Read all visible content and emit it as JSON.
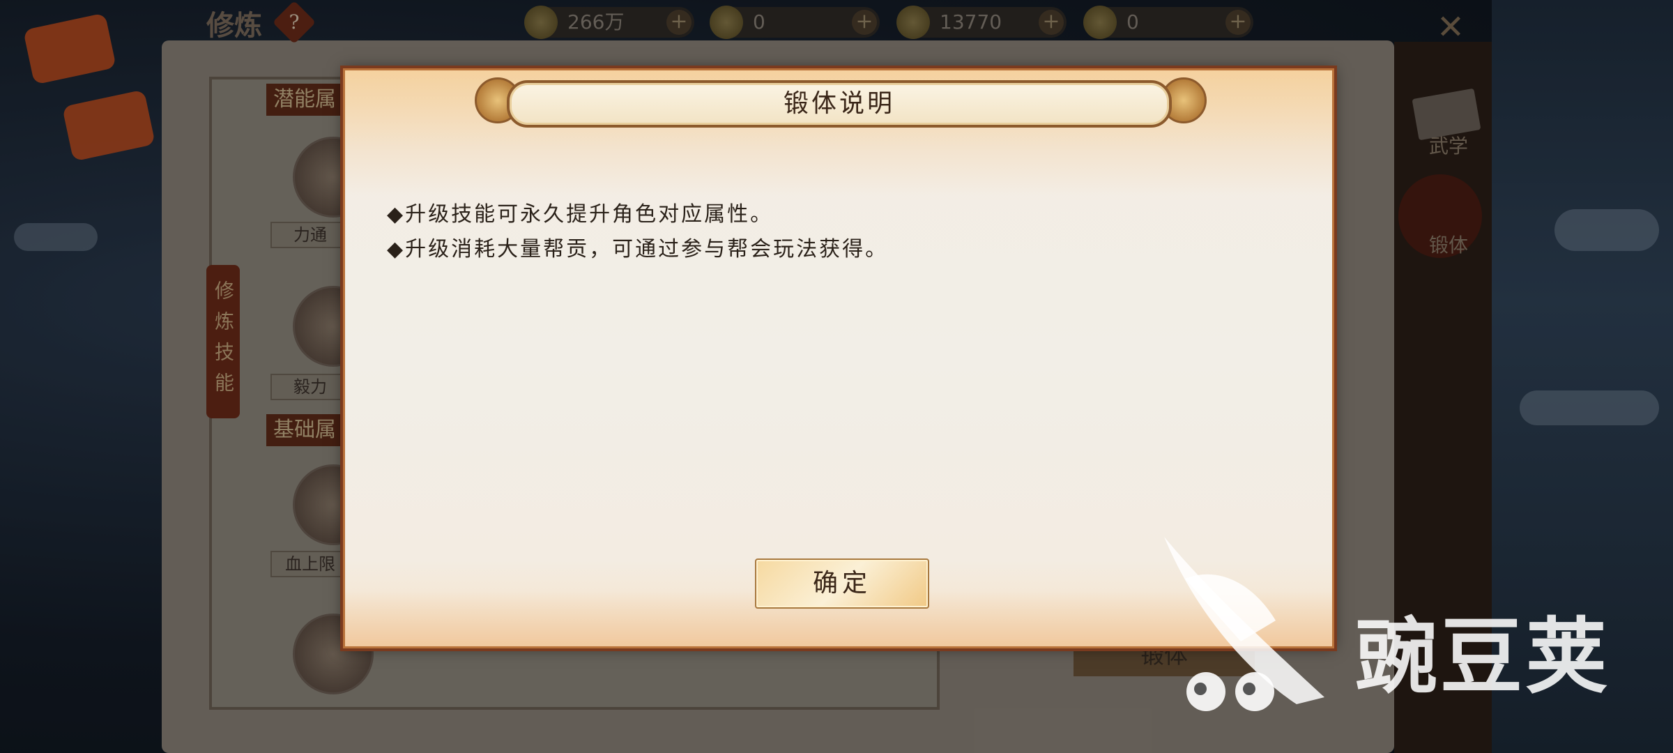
{
  "header": {
    "title": "修炼",
    "help_icon": "?",
    "currencies": [
      {
        "icon": "copper-coin-icon",
        "value": "266万"
      },
      {
        "icon": "gold-coin-icon",
        "value": "0"
      },
      {
        "icon": "silver-ingot-icon",
        "value": "13770"
      },
      {
        "icon": "gold-ingot-icon",
        "value": "0"
      }
    ],
    "plus_symbol": "+"
  },
  "left_panel": {
    "section_1_header": "潜能属",
    "skill_1_label": "力通",
    "skill_2_label": "毅力",
    "section_2_header": "基础属",
    "skill_3_label": "血上限",
    "side_tab": "修炼技能"
  },
  "right_nav": {
    "items": [
      {
        "label": "武学"
      },
      {
        "label": "锻体"
      }
    ],
    "bottom_button": "锻体"
  },
  "dialog": {
    "title": "锻体说明",
    "lines": [
      "◆升级技能可永久提升角色对应属性。",
      "◆升级消耗大量帮贡，可通过参与帮会玩法获得。"
    ],
    "confirm_label": "确定"
  },
  "watermark": {
    "text": "豌豆荚"
  }
}
